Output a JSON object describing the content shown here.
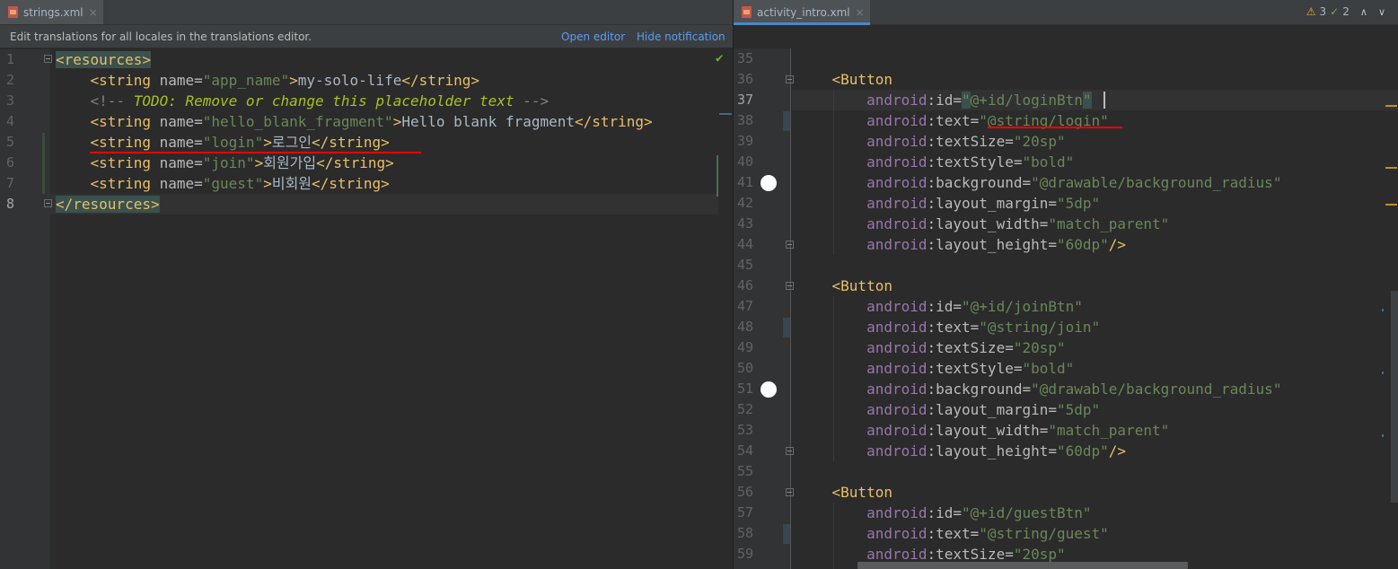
{
  "left": {
    "tab": {
      "label": "strings.xml",
      "close": "×"
    },
    "notification": {
      "message": "Edit translations for all locales in the translations editor.",
      "open_editor": "Open editor",
      "hide": "Hide notification"
    },
    "lines": [
      {
        "n": "1",
        "tokens": [
          {
            "t": "<resources>",
            "c": "tag hl-tag"
          }
        ]
      },
      {
        "n": "2",
        "tokens": [
          {
            "t": "    ",
            "c": ""
          },
          {
            "t": "<string ",
            "c": "tag"
          },
          {
            "t": "name",
            "c": "attr"
          },
          {
            "t": "=",
            "c": "attr"
          },
          {
            "t": "\"app_name\"",
            "c": "val"
          },
          {
            "t": ">",
            "c": "tag"
          },
          {
            "t": "my-solo-life",
            "c": ""
          },
          {
            "t": "</string>",
            "c": "tag"
          }
        ]
      },
      {
        "n": "3",
        "tokens": [
          {
            "t": "    ",
            "c": ""
          },
          {
            "t": "<!-- ",
            "c": "cm"
          },
          {
            "t": "TODO: Remove or change this placeholder text",
            "c": "todo"
          },
          {
            "t": " -->",
            "c": "cm"
          }
        ]
      },
      {
        "n": "4",
        "tokens": [
          {
            "t": "    ",
            "c": ""
          },
          {
            "t": "<string ",
            "c": "tag"
          },
          {
            "t": "name",
            "c": "attr"
          },
          {
            "t": "=",
            "c": "attr"
          },
          {
            "t": "\"hello_blank_fragment\"",
            "c": "val"
          },
          {
            "t": ">",
            "c": "tag"
          },
          {
            "t": "Hello blank fragment",
            "c": ""
          },
          {
            "t": "</string>",
            "c": "tag"
          }
        ]
      },
      {
        "n": "5",
        "tokens": [
          {
            "t": "    ",
            "c": ""
          },
          {
            "t": "<string ",
            "c": "tag"
          },
          {
            "t": "name",
            "c": "attr"
          },
          {
            "t": "=",
            "c": "attr"
          },
          {
            "t": "\"login\"",
            "c": "val"
          },
          {
            "t": ">",
            "c": "tag"
          },
          {
            "t": "로그인",
            "c": ""
          },
          {
            "t": "</string>",
            "c": "tag"
          }
        ]
      },
      {
        "n": "6",
        "tokens": [
          {
            "t": "    ",
            "c": ""
          },
          {
            "t": "<string ",
            "c": "tag"
          },
          {
            "t": "name",
            "c": "attr"
          },
          {
            "t": "=",
            "c": "attr"
          },
          {
            "t": "\"join\"",
            "c": "val"
          },
          {
            "t": ">",
            "c": "tag"
          },
          {
            "t": "회원가입",
            "c": ""
          },
          {
            "t": "</string>",
            "c": "tag"
          }
        ]
      },
      {
        "n": "7",
        "tokens": [
          {
            "t": "    ",
            "c": ""
          },
          {
            "t": "<string ",
            "c": "tag"
          },
          {
            "t": "name",
            "c": "attr"
          },
          {
            "t": "=",
            "c": "attr"
          },
          {
            "t": "\"guest\"",
            "c": "val"
          },
          {
            "t": ">",
            "c": "tag"
          },
          {
            "t": "비회원",
            "c": ""
          },
          {
            "t": "</string>",
            "c": "tag"
          }
        ]
      },
      {
        "n": "8",
        "tokens": [
          {
            "t": "</resources>",
            "c": "tag hl-tag"
          }
        ]
      }
    ]
  },
  "right": {
    "tab": {
      "label": "activity_intro.xml",
      "close": "×"
    },
    "inspection": {
      "warnings": "3",
      "ok": "2",
      "warn_icon": "⚠",
      "ok_icon": "✓"
    },
    "lines": [
      {
        "n": "35",
        "tokens": []
      },
      {
        "n": "36",
        "tokens": [
          {
            "t": "    ",
            "c": ""
          },
          {
            "t": "<Button",
            "c": "tag"
          }
        ]
      },
      {
        "n": "37",
        "tokens": [
          {
            "t": "        ",
            "c": ""
          },
          {
            "t": "android",
            "c": "ns"
          },
          {
            "t": ":id=",
            "c": "attr"
          },
          {
            "t": "\"",
            "c": "val match-quote"
          },
          {
            "t": "@+id/loginBtn",
            "c": "val"
          },
          {
            "t": "\"",
            "c": "val match-quote"
          }
        ]
      },
      {
        "n": "38",
        "tokens": [
          {
            "t": "        ",
            "c": ""
          },
          {
            "t": "android",
            "c": "ns"
          },
          {
            "t": ":text=",
            "c": "attr"
          },
          {
            "t": "\"@string/login\"",
            "c": "val"
          }
        ]
      },
      {
        "n": "39",
        "tokens": [
          {
            "t": "        ",
            "c": ""
          },
          {
            "t": "android",
            "c": "ns"
          },
          {
            "t": ":textSize=",
            "c": "attr"
          },
          {
            "t": "\"20sp\"",
            "c": "val"
          }
        ]
      },
      {
        "n": "40",
        "tokens": [
          {
            "t": "        ",
            "c": ""
          },
          {
            "t": "android",
            "c": "ns"
          },
          {
            "t": ":textStyle=",
            "c": "attr"
          },
          {
            "t": "\"bold\"",
            "c": "val"
          }
        ]
      },
      {
        "n": "41",
        "tokens": [
          {
            "t": "        ",
            "c": ""
          },
          {
            "t": "android",
            "c": "ns"
          },
          {
            "t": ":background=",
            "c": "attr"
          },
          {
            "t": "\"@drawable/background_radius\"",
            "c": "val"
          }
        ]
      },
      {
        "n": "42",
        "tokens": [
          {
            "t": "        ",
            "c": ""
          },
          {
            "t": "android",
            "c": "ns"
          },
          {
            "t": ":layout_margin=",
            "c": "attr"
          },
          {
            "t": "\"5dp\"",
            "c": "val"
          }
        ]
      },
      {
        "n": "43",
        "tokens": [
          {
            "t": "        ",
            "c": ""
          },
          {
            "t": "android",
            "c": "ns"
          },
          {
            "t": ":layout_width=",
            "c": "attr"
          },
          {
            "t": "\"match_parent\"",
            "c": "val"
          }
        ]
      },
      {
        "n": "44",
        "tokens": [
          {
            "t": "        ",
            "c": ""
          },
          {
            "t": "android",
            "c": "ns"
          },
          {
            "t": ":layout_height=",
            "c": "attr"
          },
          {
            "t": "\"60dp\"",
            "c": "val"
          },
          {
            "t": "/>",
            "c": "tag"
          }
        ]
      },
      {
        "n": "45",
        "tokens": []
      },
      {
        "n": "46",
        "tokens": [
          {
            "t": "    ",
            "c": ""
          },
          {
            "t": "<Button",
            "c": "tag"
          }
        ]
      },
      {
        "n": "47",
        "tokens": [
          {
            "t": "        ",
            "c": ""
          },
          {
            "t": "android",
            "c": "ns"
          },
          {
            "t": ":id=",
            "c": "attr"
          },
          {
            "t": "\"@+id/joinBtn\"",
            "c": "val"
          }
        ]
      },
      {
        "n": "48",
        "tokens": [
          {
            "t": "        ",
            "c": ""
          },
          {
            "t": "android",
            "c": "ns"
          },
          {
            "t": ":text=",
            "c": "attr"
          },
          {
            "t": "\"@string/join\"",
            "c": "val"
          }
        ]
      },
      {
        "n": "49",
        "tokens": [
          {
            "t": "        ",
            "c": ""
          },
          {
            "t": "android",
            "c": "ns"
          },
          {
            "t": ":textSize=",
            "c": "attr"
          },
          {
            "t": "\"20sp\"",
            "c": "val"
          }
        ]
      },
      {
        "n": "50",
        "tokens": [
          {
            "t": "        ",
            "c": ""
          },
          {
            "t": "android",
            "c": "ns"
          },
          {
            "t": ":textStyle=",
            "c": "attr"
          },
          {
            "t": "\"bold\"",
            "c": "val"
          }
        ]
      },
      {
        "n": "51",
        "tokens": [
          {
            "t": "        ",
            "c": ""
          },
          {
            "t": "android",
            "c": "ns"
          },
          {
            "t": ":background=",
            "c": "attr"
          },
          {
            "t": "\"@drawable/background_radius\"",
            "c": "val"
          }
        ]
      },
      {
        "n": "52",
        "tokens": [
          {
            "t": "        ",
            "c": ""
          },
          {
            "t": "android",
            "c": "ns"
          },
          {
            "t": ":layout_margin=",
            "c": "attr"
          },
          {
            "t": "\"5dp\"",
            "c": "val"
          }
        ]
      },
      {
        "n": "53",
        "tokens": [
          {
            "t": "        ",
            "c": ""
          },
          {
            "t": "android",
            "c": "ns"
          },
          {
            "t": ":layout_width=",
            "c": "attr"
          },
          {
            "t": "\"match_parent\"",
            "c": "val"
          }
        ]
      },
      {
        "n": "54",
        "tokens": [
          {
            "t": "        ",
            "c": ""
          },
          {
            "t": "android",
            "c": "ns"
          },
          {
            "t": ":layout_height=",
            "c": "attr"
          },
          {
            "t": "\"60dp\"",
            "c": "val"
          },
          {
            "t": "/>",
            "c": "tag"
          }
        ]
      },
      {
        "n": "55",
        "tokens": []
      },
      {
        "n": "56",
        "tokens": [
          {
            "t": "    ",
            "c": ""
          },
          {
            "t": "<Button",
            "c": "tag"
          }
        ]
      },
      {
        "n": "57",
        "tokens": [
          {
            "t": "        ",
            "c": ""
          },
          {
            "t": "android",
            "c": "ns"
          },
          {
            "t": ":id=",
            "c": "attr"
          },
          {
            "t": "\"@+id/guestBtn\"",
            "c": "val"
          }
        ]
      },
      {
        "n": "58",
        "tokens": [
          {
            "t": "        ",
            "c": ""
          },
          {
            "t": "android",
            "c": "ns"
          },
          {
            "t": ":text=",
            "c": "attr"
          },
          {
            "t": "\"@string/guest\"",
            "c": "val"
          }
        ]
      },
      {
        "n": "59",
        "tokens": [
          {
            "t": "        ",
            "c": ""
          },
          {
            "t": "android",
            "c": "ns"
          },
          {
            "t": ":textSize=",
            "c": "attr"
          },
          {
            "t": "\"20sp\"",
            "c": "val"
          }
        ]
      }
    ]
  },
  "colors": {
    "tag": "#e8bf6a",
    "namespace": "#9876aa",
    "value": "#6a8759",
    "text": "#a9b7c6",
    "comment": "#808080",
    "todo": "#a8c023",
    "underline": "#ff0000"
  }
}
